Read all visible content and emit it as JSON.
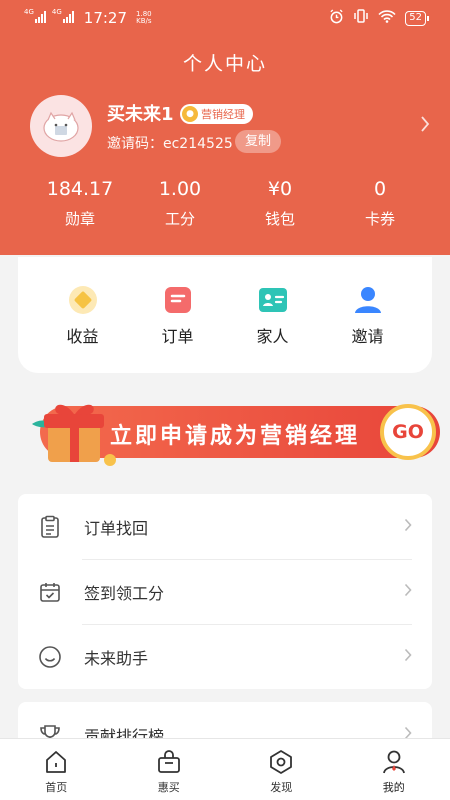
{
  "status_bar": {
    "net1": "4G",
    "net2": "4G",
    "time": "17:27",
    "speed_value": "1.80",
    "speed_unit": "KB/s",
    "battery": "52"
  },
  "header": {
    "title": "个人中心",
    "bg_color": "#e8654b"
  },
  "profile": {
    "name": "买未来1",
    "badge": "营销经理",
    "invite_label": "邀请码：ec214525",
    "copy_label": "复制"
  },
  "stats": [
    {
      "value": "184.17",
      "label": "勋章"
    },
    {
      "value": "1.00",
      "label": "工分"
    },
    {
      "value": "¥0",
      "label": "钱包"
    },
    {
      "value": "0",
      "label": "卡券"
    }
  ],
  "quick_actions": [
    {
      "label": "收益",
      "icon": "diamond-icon",
      "color": "#f6c343"
    },
    {
      "label": "订单",
      "icon": "order-icon",
      "color": "#f46b6b"
    },
    {
      "label": "家人",
      "icon": "family-card-icon",
      "color": "#2ec4b6"
    },
    {
      "label": "邀请",
      "icon": "user-icon",
      "color": "#3a86ff"
    }
  ],
  "banner": {
    "text": "立即申请成为营销经理",
    "go": "GO"
  },
  "menu": [
    {
      "label": "订单找回",
      "icon": "clipboard-icon"
    },
    {
      "label": "签到领工分",
      "icon": "calendar-check-icon"
    },
    {
      "label": "未来助手",
      "icon": "smile-icon"
    }
  ],
  "menu2": [
    {
      "label": "贡献排行榜",
      "icon": "trophy-icon"
    }
  ],
  "tabbar": [
    {
      "label": "首页",
      "icon": "home-icon"
    },
    {
      "label": "惠买",
      "icon": "shopping-bag-icon"
    },
    {
      "label": "发现",
      "icon": "discover-icon"
    },
    {
      "label": "我的",
      "icon": "profile-icon",
      "active": true
    }
  ]
}
